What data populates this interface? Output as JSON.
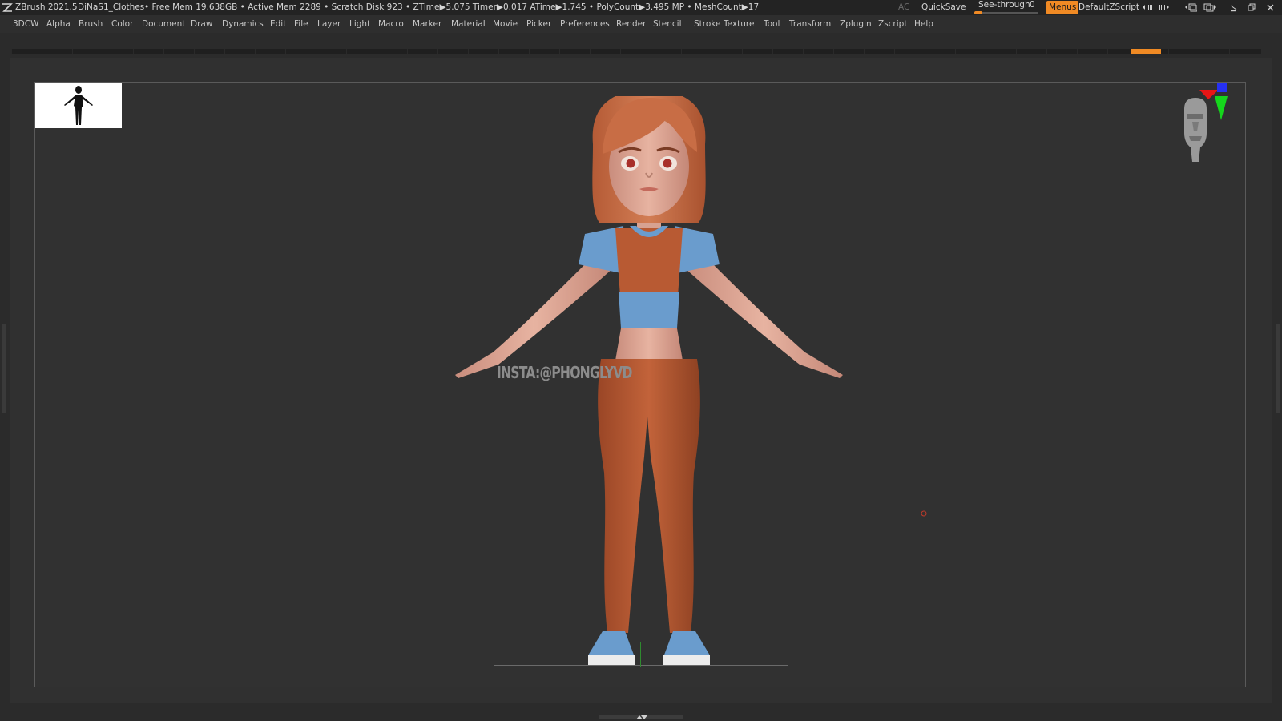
{
  "titlebar": {
    "app": "ZBrush 2021.5",
    "document": "DiNaS1_Clothes",
    "stats": "• Free Mem 19.638GB • Active Mem 2289 • Scratch Disk 923 • ZTime▶5.075 Timer▶0.017 ATime▶1.745 • PolyCount▶3.495 MP • MeshCount▶17",
    "ac": "AC",
    "quicksave": "QuickSave",
    "seethrough_label": "See-through",
    "seethrough_value": "0",
    "menus_button": "Menus",
    "script": "DefaultZScript"
  },
  "menubar": {
    "items": [
      "3DCW",
      "Alpha",
      "Brush",
      "Color",
      "Document",
      "Draw",
      "Dynamics",
      "Edit",
      "File",
      "Layer",
      "Light",
      "Macro",
      "Marker",
      "Material",
      "Movie",
      "Picker",
      "Preferences",
      "Render",
      "Stencil",
      "Stroke",
      "Texture",
      "Tool",
      "Transform",
      "Zplugin",
      "Zscript",
      "Help"
    ]
  },
  "canvas": {
    "watermark": "INSTA:@PHONGLYVD"
  },
  "colors": {
    "accent": "#f08a24",
    "skin": "#e2a896",
    "hair": "#c86d45",
    "clothes_orange": "#b85a33",
    "clothes_blue": "#6a9ccd"
  }
}
